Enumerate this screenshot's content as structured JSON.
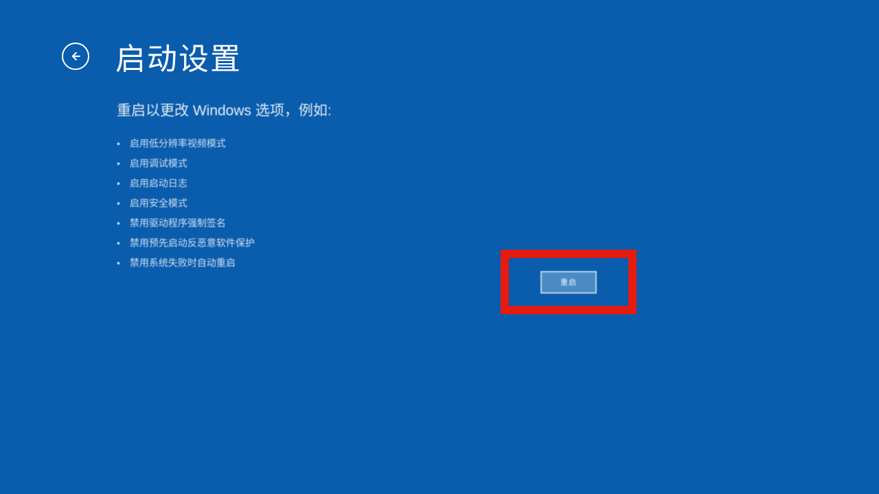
{
  "header": {
    "title": "启动设置"
  },
  "main": {
    "subtitle": "重启以更改 Windows 选项，例如:",
    "options": [
      "启用低分辨率视频模式",
      "启用调试模式",
      "启用启动日志",
      "启用安全模式",
      "禁用驱动程序强制签名",
      "禁用预先启动反恶意软件保护",
      "禁用系统失败时自动重启"
    ]
  },
  "actions": {
    "restart_label": "重启"
  }
}
